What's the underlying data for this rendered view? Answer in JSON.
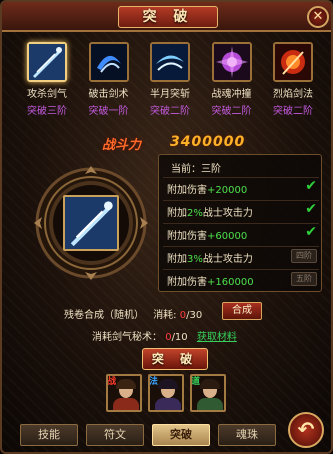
{
  "window": {
    "title": "突 破",
    "close_glyph": "✕"
  },
  "skills": [
    {
      "name": "攻杀剑气",
      "stage": "突破三阶",
      "icon": "sword-slash-icon",
      "selected": true
    },
    {
      "name": "破击剑术",
      "stage": "突破一阶",
      "icon": "blue-swirl-icon"
    },
    {
      "name": "半月突斩",
      "stage": "突破二阶",
      "icon": "crescent-strike-icon"
    },
    {
      "name": "战魂冲撞",
      "stage": "突破二阶",
      "icon": "purple-burst-icon"
    },
    {
      "name": "烈焰剑法",
      "stage": "突破二阶",
      "icon": "flame-sword-icon"
    }
  ],
  "power": {
    "label": "战斗力",
    "value": "3400000"
  },
  "stats": {
    "current_label": "当前：三阶",
    "rows": [
      {
        "pre": "附加伤害",
        "num": "+20000",
        "post": "",
        "status": "check"
      },
      {
        "pre": "附加",
        "num": "2%",
        "post": "战士攻击力",
        "status": "check"
      },
      {
        "pre": "附加伤害",
        "num": "+60000",
        "post": "",
        "status": "check"
      },
      {
        "pre": "附加",
        "num": "3%",
        "post": "战士攻击力",
        "status": "四阶"
      },
      {
        "pre": "附加伤害",
        "num": "+160000",
        "post": "",
        "status": "五阶"
      }
    ]
  },
  "materials": {
    "scroll_label": "残卷合成（随机）",
    "consume_label": "消耗:",
    "scroll_have": "0",
    "scroll_need": "/30",
    "synth_label": "合成",
    "secret_label": "消耗剑气秘术：",
    "secret_have": "0",
    "secret_need": "/10",
    "get_label": "获取材料"
  },
  "break_label": "突 破",
  "heroes": [
    {
      "badge": "战",
      "badge_color": "#ff3b2b",
      "hair": "#3b2314",
      "body": "#8a2a1a"
    },
    {
      "badge": "法",
      "badge_color": "#38a3ff",
      "hair": "#1c1420",
      "body": "#3a2a5a"
    },
    {
      "badge": "道",
      "badge_color": "#36d15a",
      "hair": "#2a1a10",
      "body": "#2f5a32"
    }
  ],
  "tabs": [
    "技能",
    "符文",
    "突破",
    "魂珠"
  ],
  "active_tab": 2,
  "back_glyph": "↶"
}
